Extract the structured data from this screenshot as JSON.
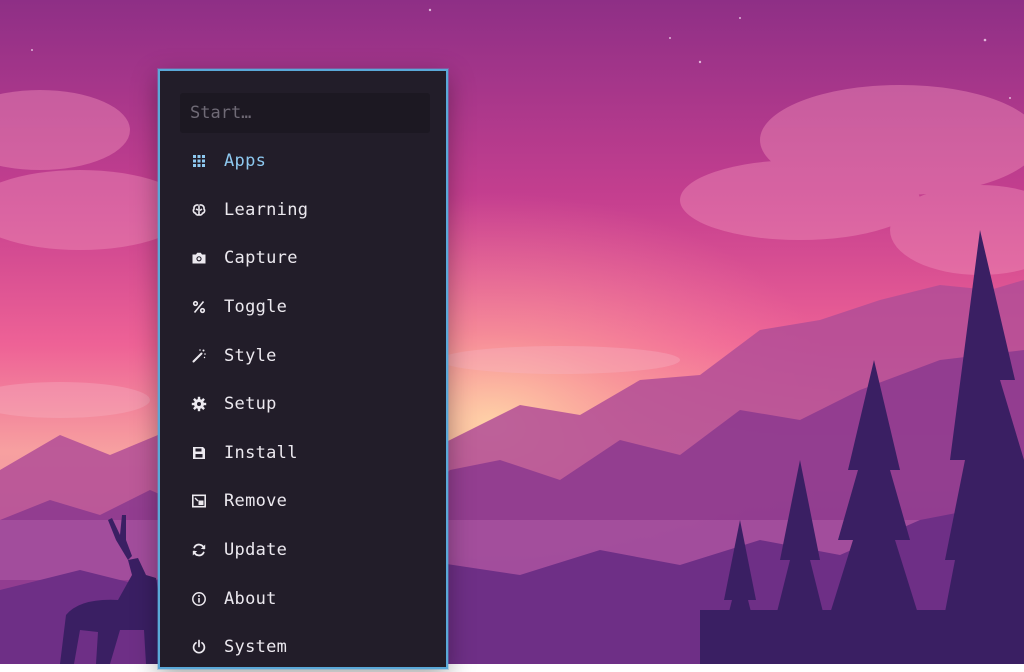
{
  "launcher": {
    "search_placeholder": "Start…",
    "items": [
      {
        "label": "Apps",
        "icon": "grid-icon",
        "active": true
      },
      {
        "label": "Learning",
        "icon": "brain-icon",
        "active": false
      },
      {
        "label": "Capture",
        "icon": "camera-icon",
        "active": false
      },
      {
        "label": "Toggle",
        "icon": "toggle-percent-icon",
        "active": false
      },
      {
        "label": "Style",
        "icon": "magic-wand-icon",
        "active": false
      },
      {
        "label": "Setup",
        "icon": "gear-icon",
        "active": false
      },
      {
        "label": "Install",
        "icon": "save-icon",
        "active": false
      },
      {
        "label": "Remove",
        "icon": "remove-box-icon",
        "active": false
      },
      {
        "label": "Update",
        "icon": "refresh-icon",
        "active": false
      },
      {
        "label": "About",
        "icon": "info-icon",
        "active": false
      },
      {
        "label": "System",
        "icon": "power-icon",
        "active": false
      }
    ]
  },
  "colors": {
    "accent": "#8ec9f0",
    "border": "#5aa8d8",
    "panel": "#221d29",
    "text": "#ece9ef"
  }
}
